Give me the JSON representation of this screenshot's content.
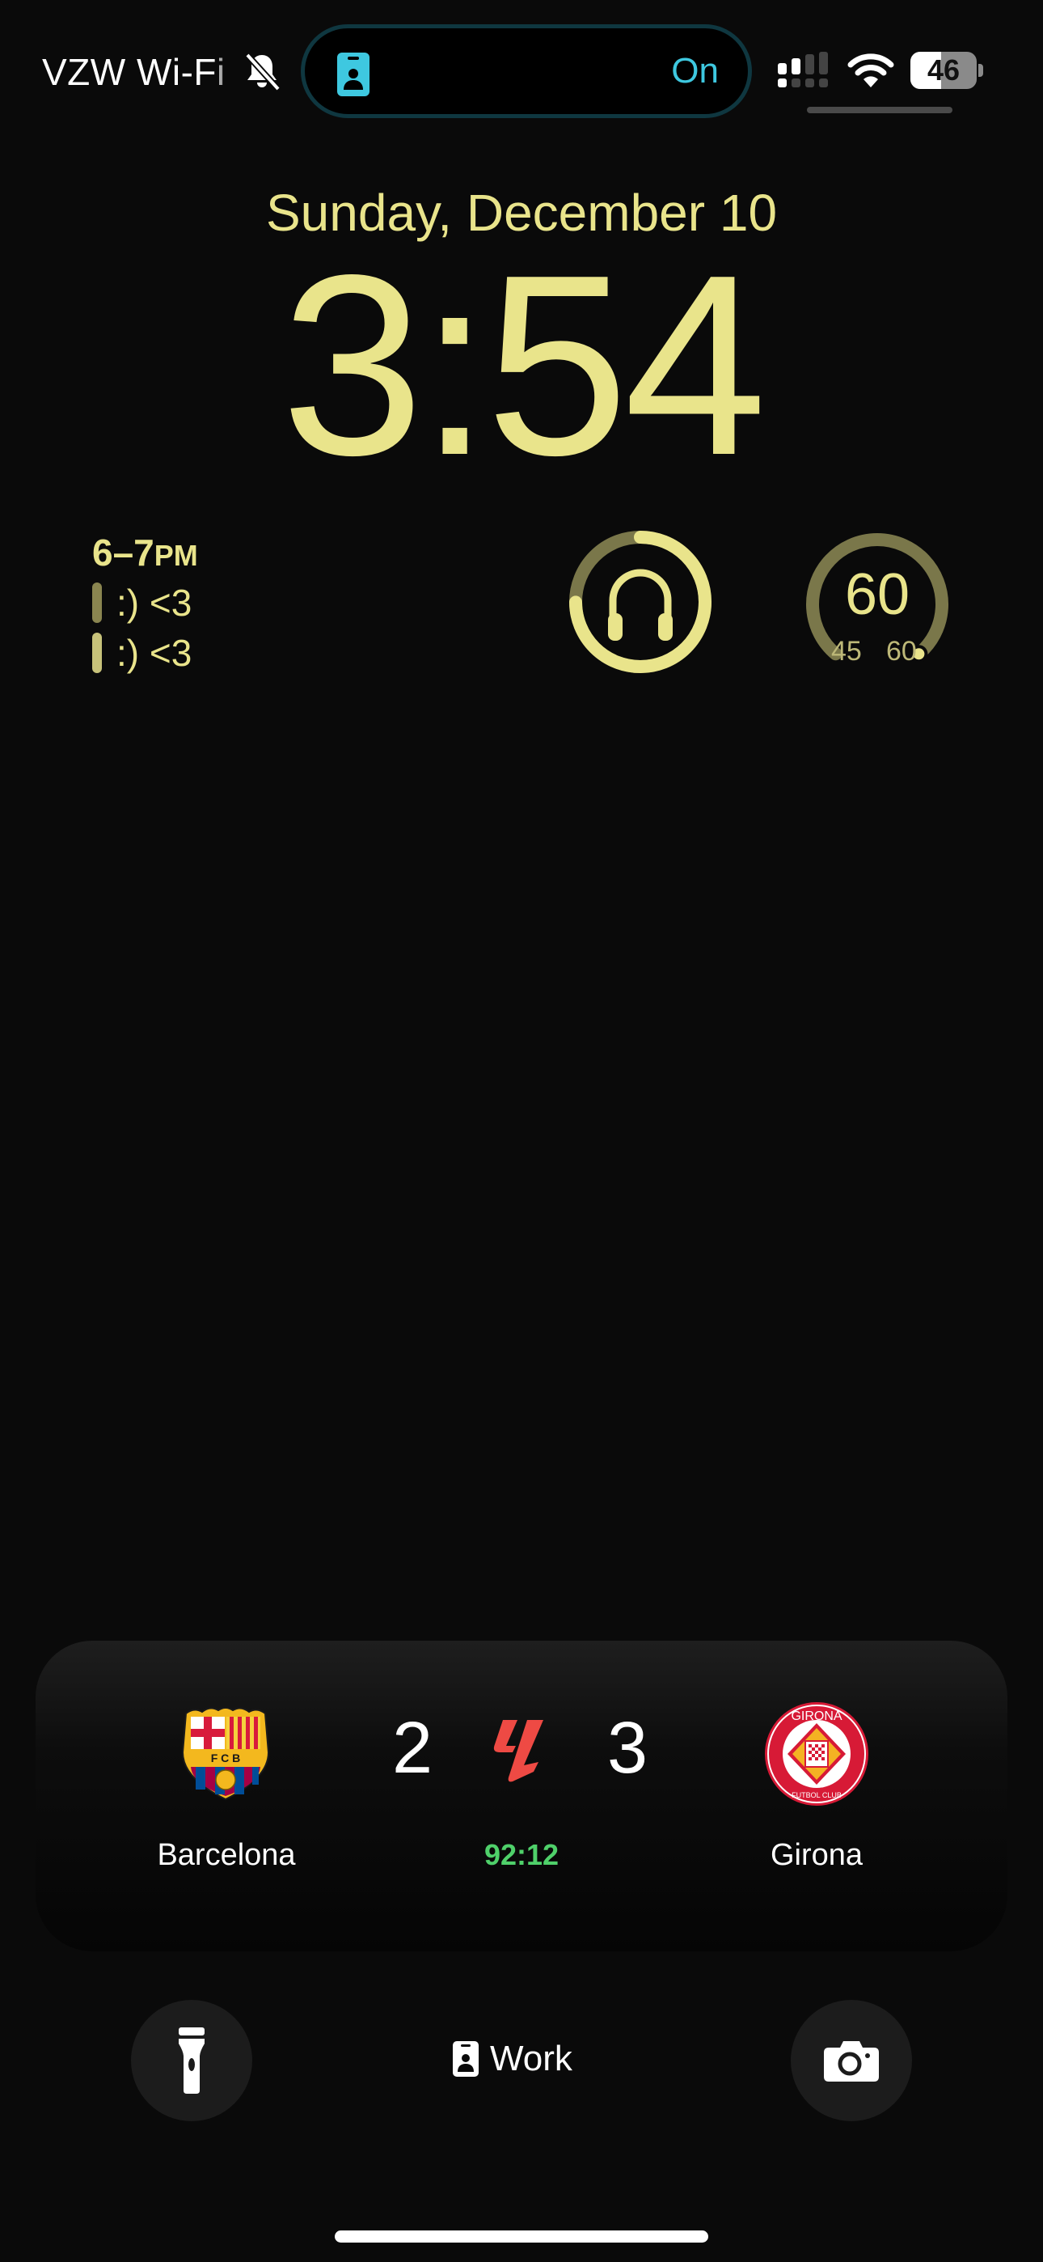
{
  "status_bar": {
    "carrier": "VZW Wi-Fi",
    "silent_icon": "bell-slash-icon",
    "signal_icon": "cellular-signal-icon",
    "wifi_icon": "wifi-icon",
    "battery_percent": "46",
    "battery_level": 0.46
  },
  "dynamic_island": {
    "icon": "person-badge-icon",
    "status": "On",
    "accent": "#3ec8e0"
  },
  "lock_screen": {
    "date": "Sunday, December 10",
    "time": "3:54",
    "accent": "#e9e48b"
  },
  "widgets": {
    "calendar": {
      "time_range": "6–7",
      "period": "PM",
      "events": [
        ":) <3",
        ":) <3"
      ]
    },
    "headphones": {
      "icon": "headphones-icon",
      "level": 0.75
    },
    "gauge": {
      "value": "60",
      "min": "45",
      "max": "60",
      "level": 1.0
    }
  },
  "score_card": {
    "home_team": "Barcelona",
    "home_score": "2",
    "away_team": "Girona",
    "away_score": "3",
    "match_clock": "92:12",
    "league_icon": "laliga-logo",
    "home_crest": "fc-barcelona-crest",
    "away_crest": "girona-fc-crest"
  },
  "bottom_bar": {
    "flashlight_icon": "flashlight-icon",
    "focus_label": "Work",
    "focus_icon": "person-badge-icon",
    "camera_icon": "camera-icon"
  }
}
